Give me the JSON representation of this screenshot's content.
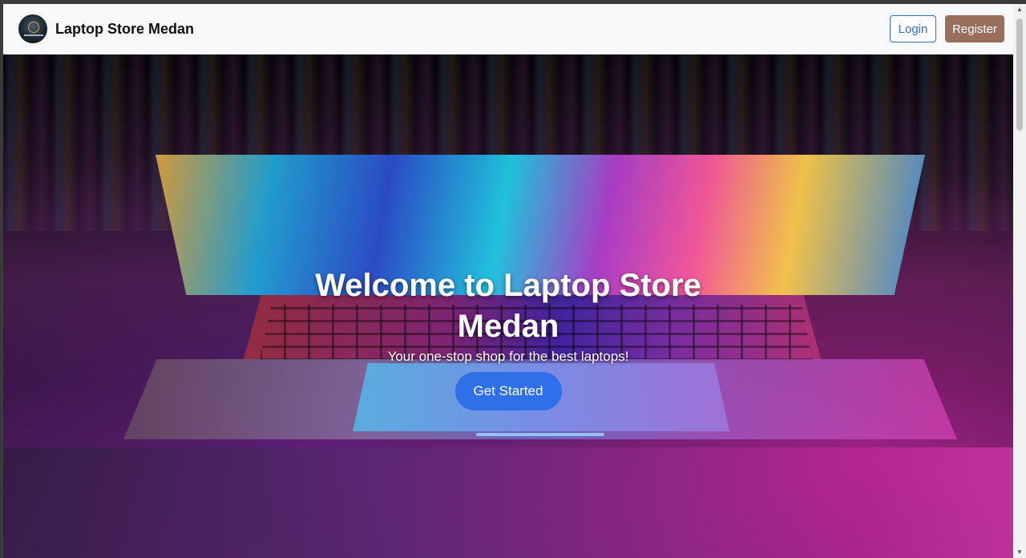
{
  "navbar": {
    "brand_name": "Laptop Store Medan",
    "logo_icon": "store-logo-icon",
    "login_label": "Login",
    "register_label": "Register",
    "colors": {
      "login_border": "#2f6fd6",
      "register_bg": "#9a6e5c"
    }
  },
  "hero": {
    "title": "Welcome to Laptop Store Medan",
    "subtitle": "Your one-stop shop for the best laptops!",
    "cta_label": "Get Started",
    "background_image": "laptop-colorful-keyboard-image",
    "colors": {
      "cta_bg": "#2f6fe8"
    }
  },
  "scrollbar": {
    "up_icon": "scroll-up-arrow-icon",
    "down_icon": "scroll-down-arrow-icon"
  }
}
